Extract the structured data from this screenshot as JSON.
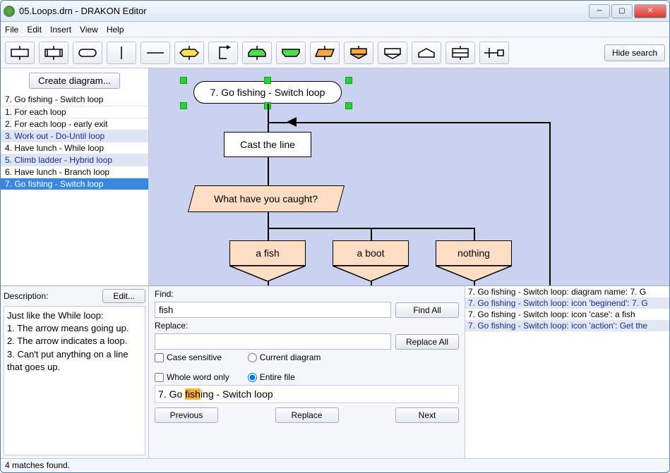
{
  "window": {
    "title": "05.Loops.drn - DRAKON Editor"
  },
  "menu": [
    "File",
    "Edit",
    "Insert",
    "View",
    "Help"
  ],
  "toolbar": {
    "hide_search": "Hide search"
  },
  "sidebar": {
    "create": "Create diagram...",
    "current": "7. Go fishing - Switch loop",
    "items": [
      {
        "label": "1. For each loop",
        "alt": false
      },
      {
        "label": "2. For each loop - early exit",
        "alt": false
      },
      {
        "label": "3. Work out - Do-Until loop",
        "alt": true
      },
      {
        "label": "4. Have lunch - While loop",
        "alt": false
      },
      {
        "label": "5. Climb ladder - Hybrid loop",
        "alt": true
      },
      {
        "label": "6. Have lunch - Branch loop",
        "alt": false
      },
      {
        "label": "7. Go fishing - Switch loop",
        "alt": false,
        "sel": true
      }
    ]
  },
  "diagram": {
    "title": "7. Go fishing - Switch loop",
    "action": "Cast the line",
    "question": "What have you caught?",
    "cases": [
      "a fish",
      "a boot",
      "nothing"
    ]
  },
  "description": {
    "label": "Description:",
    "edit": "Edit...",
    "text": "Just like the While loop:\n1. The arrow means going up.\n2. The arrow indicates a loop.\n3. Can't put anything on a line that goes up."
  },
  "search": {
    "find_label": "Find:",
    "find_value": "fish",
    "replace_label": "Replace:",
    "replace_value": "",
    "findall": "Find All",
    "replaceall": "Replace All",
    "case_sensitive": "Case sensitive",
    "whole_word": "Whole word only",
    "current_diagram": "Current diagram",
    "entire_file": "Entire file",
    "current_before": "7. Go ",
    "current_hl": "fish",
    "current_after": "ing - Switch loop",
    "prev": "Previous",
    "replace": "Replace",
    "next": "Next"
  },
  "results": [
    {
      "text": "7. Go fishing - Switch loop: diagram name: 7. G",
      "alt": false
    },
    {
      "text": "7. Go fishing - Switch loop: icon 'beginend': 7. G",
      "alt": true
    },
    {
      "text": "7. Go fishing - Switch loop: icon 'case': a fish",
      "alt": false
    },
    {
      "text": "7. Go fishing - Switch loop: icon 'action': Get the",
      "alt": true
    }
  ],
  "status": "4 matches found."
}
